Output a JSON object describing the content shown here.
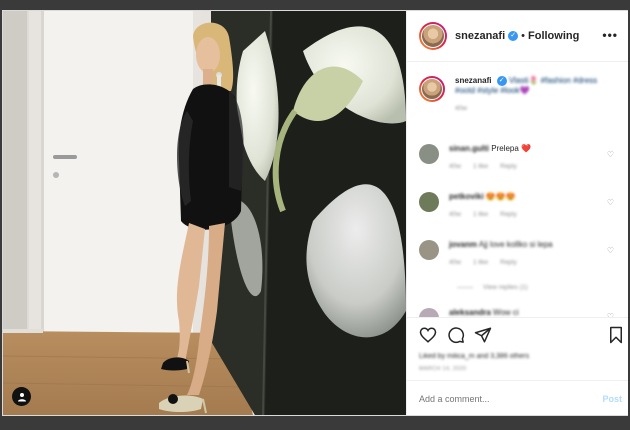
{
  "post": {
    "username": "snezanafi",
    "verified": true,
    "follow_status": "Following",
    "more_label": "•••"
  },
  "caption": {
    "username": "snezanafi",
    "text_line1": "Vlasti🌷 #fashion #dress",
    "text_line2": "#ootd #style #look💜",
    "age": "40w"
  },
  "comments": [
    {
      "username": "sinan.gulti",
      "text": "Prelepa ❤️",
      "age": "40w",
      "likes": "1 like",
      "reply": "Reply"
    },
    {
      "username": "petkoviki",
      "text": "😍😍😍",
      "age": "40w",
      "likes": "1 like",
      "reply": "Reply"
    },
    {
      "username": "jovanm",
      "text": "Ajj love kollko si lepa",
      "age": "40w",
      "likes": "1 like",
      "reply": "Reply",
      "view_replies": "View replies (1)"
    },
    {
      "username": "aleksandra",
      "text": "Wow ci",
      "age": "",
      "likes": "",
      "reply": ""
    }
  ],
  "likes_text": "Liked by milica_m and 3,386 others",
  "date_text": "MARCH 14, 2020",
  "add_comment_placeholder": "Add a comment...",
  "post_button": "Post",
  "colors": {
    "accent": "#3897f0",
    "post_disabled": "#b3dbff"
  }
}
